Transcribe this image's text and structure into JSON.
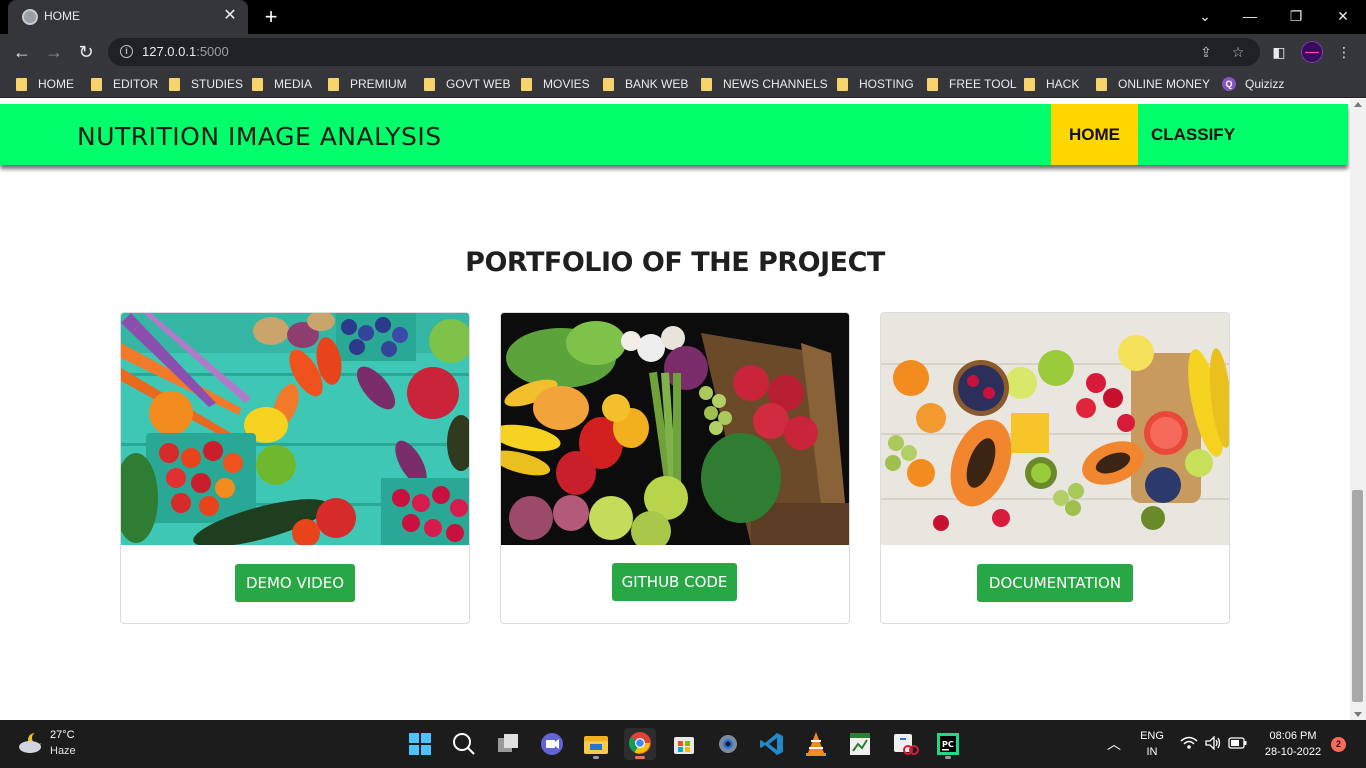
{
  "browser": {
    "tab_title": "HOME",
    "url_host": "127.0.0.1",
    "url_port": ":5000",
    "bookmarks": [
      {
        "label": "HOME",
        "type": "folder"
      },
      {
        "label": "EDITOR",
        "type": "folder"
      },
      {
        "label": "STUDIES",
        "type": "folder"
      },
      {
        "label": "MEDIA",
        "type": "folder"
      },
      {
        "label": "PREMIUM",
        "type": "folder"
      },
      {
        "label": "GOVT WEB",
        "type": "folder"
      },
      {
        "label": "MOVIES",
        "type": "folder"
      },
      {
        "label": "BANK WEB",
        "type": "folder"
      },
      {
        "label": "NEWS CHANNELS",
        "type": "folder"
      },
      {
        "label": "HOSTING",
        "type": "folder"
      },
      {
        "label": "FREE TOOL",
        "type": "folder"
      },
      {
        "label": "HACK",
        "type": "folder"
      },
      {
        "label": "ONLINE MONEY",
        "type": "folder"
      },
      {
        "label": "Quizizz",
        "type": "site"
      }
    ]
  },
  "site": {
    "brand": "NUTRITION IMAGE ANALYSIS",
    "nav": {
      "home": "HOME",
      "classify": "CLASSIFY"
    },
    "accent_color": "#00ff6a",
    "active_nav_color": "#ffd700"
  },
  "portfolio": {
    "title": "PORTFOLIO OF THE PROJECT",
    "cards": [
      {
        "button": "DEMO VIDEO",
        "image": "vegetables-and-fruits-on-teal-wood"
      },
      {
        "button": "GITHUB CODE",
        "image": "vegetable-crate-on-dark-background"
      },
      {
        "button": "DOCUMENTATION",
        "image": "sliced-fruits-on-white-wood"
      }
    ],
    "button_color": "#28a745"
  },
  "taskbar": {
    "weather_temp": "27°C",
    "weather_desc": "Haze",
    "lang": "ENG",
    "region": "IN",
    "time": "08:06 PM",
    "date": "28-10-2022",
    "notifications": "2"
  }
}
